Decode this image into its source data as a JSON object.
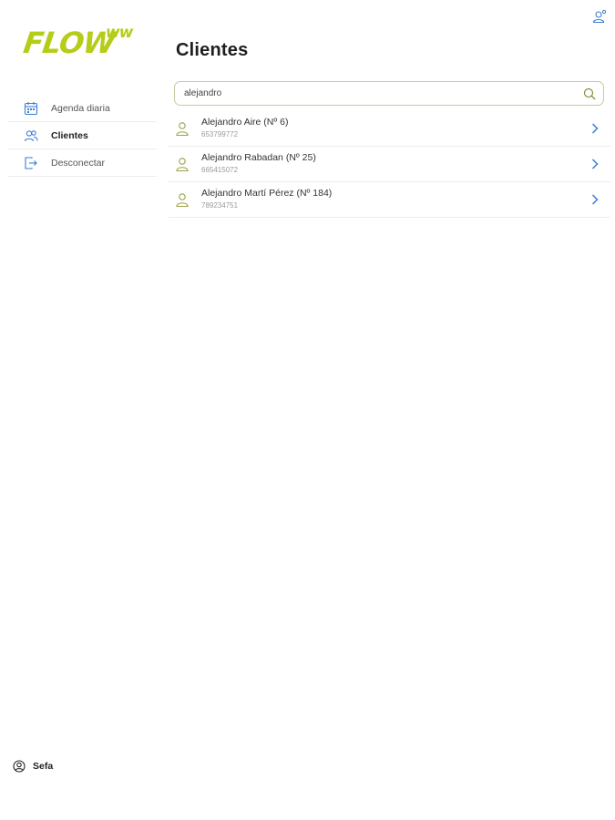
{
  "brand": {
    "logo_text": "FLOW",
    "logo_sup": "ww",
    "color": "#b5cc18"
  },
  "sidebar": {
    "items": [
      {
        "label": "Agenda diaria",
        "icon": "calendar-icon",
        "active": false
      },
      {
        "label": "Clientes",
        "icon": "users-icon",
        "active": true
      },
      {
        "label": "Desconectar",
        "icon": "logout-icon",
        "active": false
      }
    ],
    "user": {
      "name": "Sefa",
      "icon": "user-circle-icon"
    }
  },
  "header": {
    "user_settings_icon": "user-settings-icon"
  },
  "main": {
    "title": "Clientes",
    "search": {
      "value": "alejandro",
      "placeholder": "",
      "icon": "search-icon"
    },
    "clients": [
      {
        "name": "Alejandro Aire (Nº 6)",
        "phone": "653799772"
      },
      {
        "name": "Alejandro Rabadan (Nº 25)",
        "phone": "665415072"
      },
      {
        "name": "Alejandro Martí Pérez (Nº 184)",
        "phone": "789234751"
      }
    ]
  },
  "colors": {
    "accent_blue": "#3b7dd8",
    "avatar_olive": "#9ea14a",
    "search_border": "#c9c9a0"
  }
}
